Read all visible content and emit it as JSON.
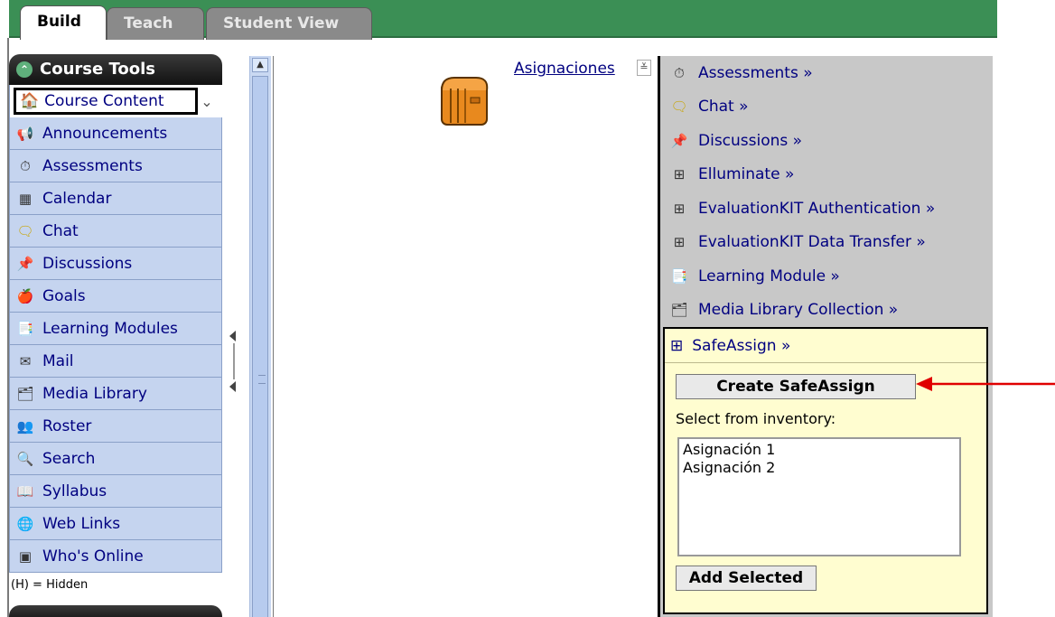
{
  "tabs": [
    {
      "label": "Build"
    },
    {
      "label": "Teach"
    },
    {
      "label": "Student View"
    }
  ],
  "sidebar": {
    "header": "Course Tools",
    "selected": "Course Content",
    "items": [
      {
        "label": "Announcements",
        "icon": "announcements-icon"
      },
      {
        "label": "Assessments",
        "icon": "assessments-icon"
      },
      {
        "label": "Calendar",
        "icon": "calendar-icon"
      },
      {
        "label": "Chat",
        "icon": "chat-icon"
      },
      {
        "label": "Discussions",
        "icon": "discussions-icon"
      },
      {
        "label": "Goals",
        "icon": "goals-icon"
      },
      {
        "label": "Learning Modules",
        "icon": "learning-modules-icon"
      },
      {
        "label": "Mail",
        "icon": "mail-icon"
      },
      {
        "label": "Media Library",
        "icon": "media-library-icon"
      },
      {
        "label": "Roster",
        "icon": "roster-icon"
      },
      {
        "label": "Search",
        "icon": "search-icon"
      },
      {
        "label": "Syllabus",
        "icon": "syllabus-icon"
      },
      {
        "label": "Web Links",
        "icon": "web-links-icon"
      },
      {
        "label": "Who's Online",
        "icon": "whos-online-icon"
      }
    ],
    "hidden_note": "(H) = Hidden"
  },
  "content": {
    "folder_link": "Asignaciones"
  },
  "add_panel": {
    "items": [
      {
        "label": "Assessments »"
      },
      {
        "label": "Chat »"
      },
      {
        "label": "Discussions »"
      },
      {
        "label": "Elluminate »"
      },
      {
        "label": "EvaluationKIT Authentication »"
      },
      {
        "label": "EvaluationKIT Data Transfer »"
      },
      {
        "label": "Learning Module »"
      },
      {
        "label": "Media Library Collection »"
      }
    ],
    "safeassign": {
      "title": "SafeAssign »",
      "create_label": "Create SafeAssign",
      "select_label": "Select from inventory:",
      "inventory": [
        "Asignación 1",
        "Asignación 2"
      ],
      "add_label": "Add Selected"
    }
  },
  "colors": {
    "tabbar_green": "#3b8f55",
    "sidebar_item_bg": "#c5d4ef",
    "link_navy": "#000080",
    "safeassign_bg": "#fffdd0",
    "annotation_red": "#e00000"
  }
}
